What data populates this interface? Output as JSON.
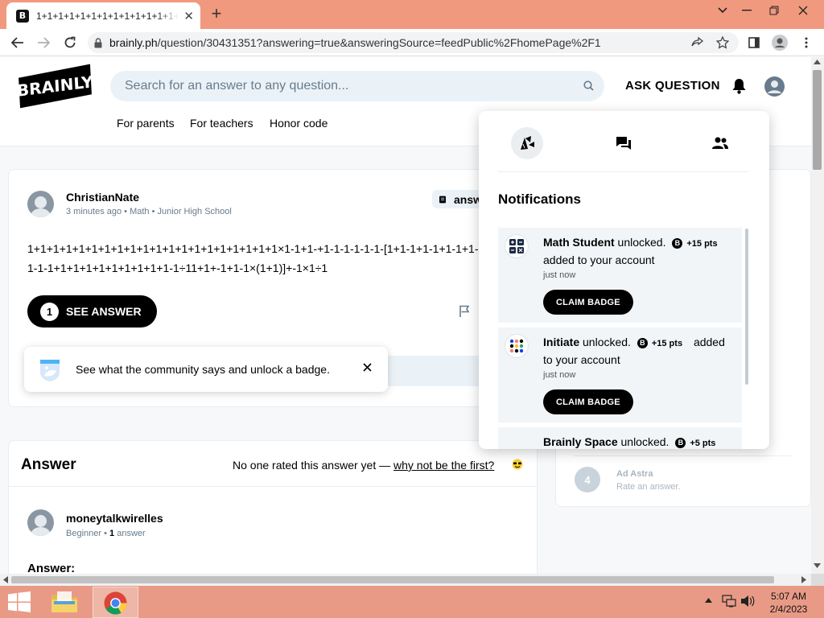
{
  "browser": {
    "tab_title": "1+1+1+1+1+1+1+1+1+1+1+1+1+1+1+1+1-1",
    "tab_favicon": "B",
    "url_host": "brainly.ph",
    "url_path": "/question/30431351?answering=true&answeringSource=feedPublic%2FhomePage%2F1"
  },
  "header": {
    "logo": "BRAINLY",
    "search_placeholder": "Search for an answer to any question...",
    "ask_question": "ASK QUESTION",
    "links": [
      "For parents",
      "For teachers",
      "Honor code"
    ]
  },
  "question": {
    "author": "ChristianNate",
    "time": "3 minutes ago",
    "subject": "Math",
    "level": "Junior High School",
    "answer_btn_label": "answ",
    "text_line1": "1+1+1+1+1+1+1+1+1+1+1+1+1+1+1+1+1+1+1+1×1-1+1-+1-1-1-1-1-1-[1+1-1+1-1+1-1+1-1+1-1-1(",
    "text_line2": "1-1-1+1+1+1+1+1+1+1+1+1-1÷11+1+-1+1-1×(1+1)]+-1×1÷1",
    "see_answer_count": "1",
    "see_answer_label": "SEE ANSWER"
  },
  "toast": {
    "text": "See what the community says and unlock a badge."
  },
  "answer_section": {
    "heading": "Answer",
    "rating_prefix": "No one rated this answer yet — ",
    "rating_link": "why not be the first?",
    "author": "moneytalkwirelles",
    "rank": "Beginner",
    "answers_count": "1",
    "answers_word": "answer",
    "answer_label": "Answer:"
  },
  "side_panel": {
    "step_number": "4",
    "step_title": "Ad Astra",
    "step_desc": "Rate an answer."
  },
  "notifications": {
    "title": "Notifications",
    "items": [
      {
        "name": "Math Student",
        "verb": " unlocked.",
        "pts": "+15 pts",
        "rest": "added to your account",
        "when": "just now",
        "button": "CLAIM BADGE"
      },
      {
        "name": "Initiate",
        "verb": " unlocked.",
        "pts": "+15 pts",
        "rest": "added",
        "rest2": "to your account",
        "when": "just now",
        "button": "CLAIM BADGE"
      },
      {
        "name": "Brainly Space",
        "verb": " unlocked.",
        "pts": "+5 pts"
      }
    ]
  },
  "taskbar": {
    "time": "5:07 AM",
    "date": "2/4/2023"
  },
  "colors": {
    "titlebar": "#f1997e",
    "taskbar": "#e89a86",
    "search_bg": "#ebf2f7",
    "accent_black": "#000000"
  }
}
